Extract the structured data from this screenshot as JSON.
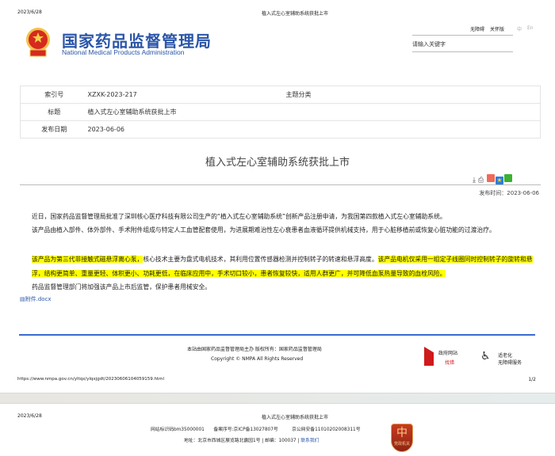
{
  "print_header": {
    "date": "2023/6/28",
    "title": "植入式左心室辅助系统获批上市"
  },
  "site": {
    "name_cn": "国家药品监督管理局",
    "name_en": "National Medical Products Administration",
    "links": [
      "无障碍",
      "关怀版"
    ],
    "lang": [
      "中",
      "En"
    ],
    "search_placeholder": "请输入关键字"
  },
  "meta": {
    "index_label": "索引号",
    "index_value": "XZXK-2023-217",
    "topic_label": "主题分类",
    "topic_value": "",
    "title_label": "标题",
    "title_value": "植入式左心室辅助系统获批上市",
    "date_label": "发布日期",
    "date_value": "2023-06-06"
  },
  "article": {
    "title": "植入式左心室辅助系统获批上市",
    "publish_time": "发布时间：2023-06-06",
    "p1": "近日，国家药品监督管理局批准了深圳核心医疗科技有限公司生产的“植入式左心室辅助系统”创新产品注册申请，为我国第四款植入式左心室辅助系统。",
    "p2": "该产品由植入部件、体外部件、手术附件组成与特定人工血管配套使用，为进展期难治性左心衰患者血液循环提供机械支持，用于心脏移植前或恢复心脏功能的过渡治疗。",
    "p3a": "该产品为第三代非接触式磁悬浮离心泵，",
    "p3b": "核心技术主要为盘式电机技术，其利用位置传感器检测并控制转子的转速和悬浮高度。",
    "p3c": "该产品电机仅采用一组定子线圈同时控制转子的旋转和悬浮，结构更简单、重量更轻、体积更小、功耗更低，在临床应用中，手术切口较小，患者恢复较快，适用人群更广，并可降低血泵热量导致的血栓风险。",
    "p4": "药品监督管理部门将加强该产品上市后监管，保护患者用械安全。",
    "attachment": "附件.docx"
  },
  "footer": {
    "sponsor": "本站由国家药品监督管理局主办 版权所有：国家药品监督管理局",
    "copyright": "Copyright © NMPA All Rights Reserved",
    "gov_error_1": "政府网站",
    "gov_error_2": "找错",
    "a11y_1": "适老化",
    "a11y_2": "无障碍服务"
  },
  "print_footer": {
    "url": "https://www.nmpa.gov.cn/yltqx/ylqxjgdt/20230606104059159.html",
    "page": "1/2"
  },
  "page2": {
    "date": "2023/6/28",
    "title": "植入式左心室辅助系统获批上市",
    "line1": "网站标识码bm35000001　　备案序号:京ICP备13027807号　　　京公网安备11010202008311号",
    "address": "地址：北京市西城区展览路北露园1号 | 邮编：100037 |",
    "contact": "联系我们",
    "badge": "党政机关"
  },
  "colors": {
    "brand": "#2a55a8",
    "highlight": "#ffff00"
  }
}
